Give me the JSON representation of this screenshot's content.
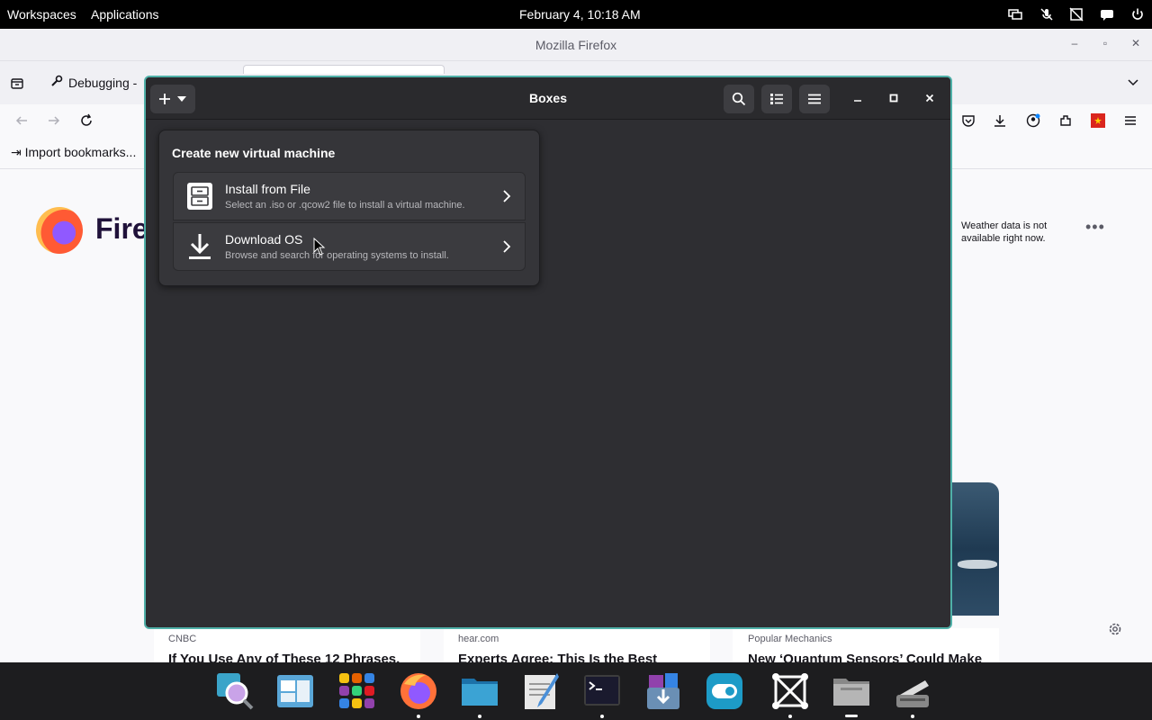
{
  "topbar": {
    "workspaces": "Workspaces",
    "applications": "Applications",
    "clock": "February 4, 10:18 AM",
    "indicators": [
      "display-icon",
      "muted-mic-icon",
      "no-network-icon",
      "chat-icon",
      "power-icon"
    ]
  },
  "firefox": {
    "window_title": "Mozilla Firefox",
    "tab_label": "Debugging -",
    "bookmarks_import": "Import bookmarks...",
    "logo_text": "Fire",
    "weather_text": "Weather data is not available right now.",
    "stories": [
      {
        "source": "CNBC",
        "headline": "If You Use Any of These 12 Phrases,"
      },
      {
        "source": "hear.com",
        "headline": "Experts Agree: This Is the Best"
      },
      {
        "source": "Popular Mechanics",
        "headline": "New ‘Quantum Sensors’ Could Make"
      }
    ]
  },
  "boxes": {
    "title": "Boxes",
    "popover": {
      "title": "Create new virtual machine",
      "items": [
        {
          "title": "Install from File",
          "subtitle": "Select an .iso or .qcow2 file to install a virtual machine."
        },
        {
          "title": "Download OS",
          "subtitle": "Browse and search for operating systems to install."
        }
      ]
    }
  },
  "dock": {
    "apps": [
      "search-app-icon",
      "files-manager-icon",
      "app-grid-icon",
      "firefox-icon",
      "folder-icon",
      "text-editor-icon",
      "terminal-icon",
      "software-center-icon",
      "toggle-app-icon",
      "boxes-app-icon",
      "files-icon",
      "scanner-icon"
    ]
  },
  "colors": {
    "accent": "#4fb0a8",
    "boxes_bg": "#2e2e32",
    "dock_bg": "#1d1d1f"
  }
}
